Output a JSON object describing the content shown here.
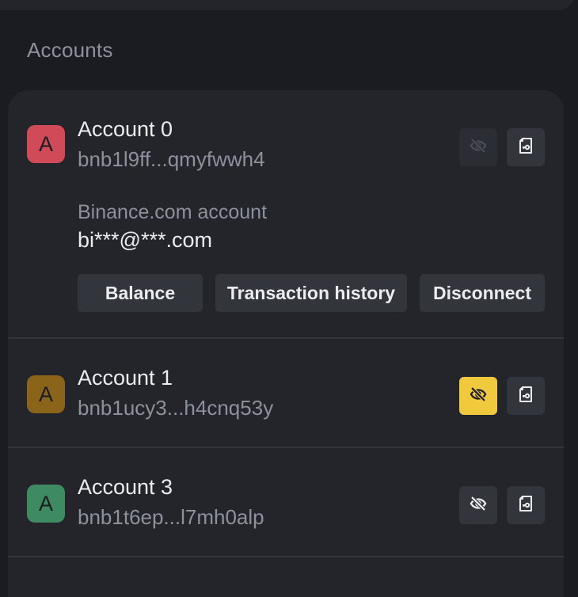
{
  "section_title": "Accounts",
  "colors": {
    "background": "#1a1c21",
    "card": "#23252b",
    "accent": "#f0c93c"
  },
  "accounts": [
    {
      "avatar_letter": "A",
      "avatar_color": "#d04a58",
      "name": "Account 0",
      "address": "bnb1l9ff...qmyfwwh4",
      "hidden": false,
      "linked_label": "Binance.com account",
      "linked_email": "bi***@***.com",
      "actions": [
        "Balance",
        "Transaction history",
        "Disconnect"
      ],
      "icons": [
        "eye-slash-icon",
        "file-key-icon"
      ]
    },
    {
      "avatar_letter": "A",
      "avatar_color": "#8a6418",
      "name": "Account 1",
      "address": "bnb1ucy3...h4cnq53y",
      "hidden": true,
      "icons": [
        "eye-slash-icon",
        "file-key-icon"
      ]
    },
    {
      "avatar_letter": "A",
      "avatar_color": "#3e8a62",
      "name": "Account 3",
      "address": "bnb1t6ep...l7mh0alp",
      "hidden": false,
      "icons": [
        "eye-slash-icon",
        "file-key-icon"
      ]
    }
  ]
}
